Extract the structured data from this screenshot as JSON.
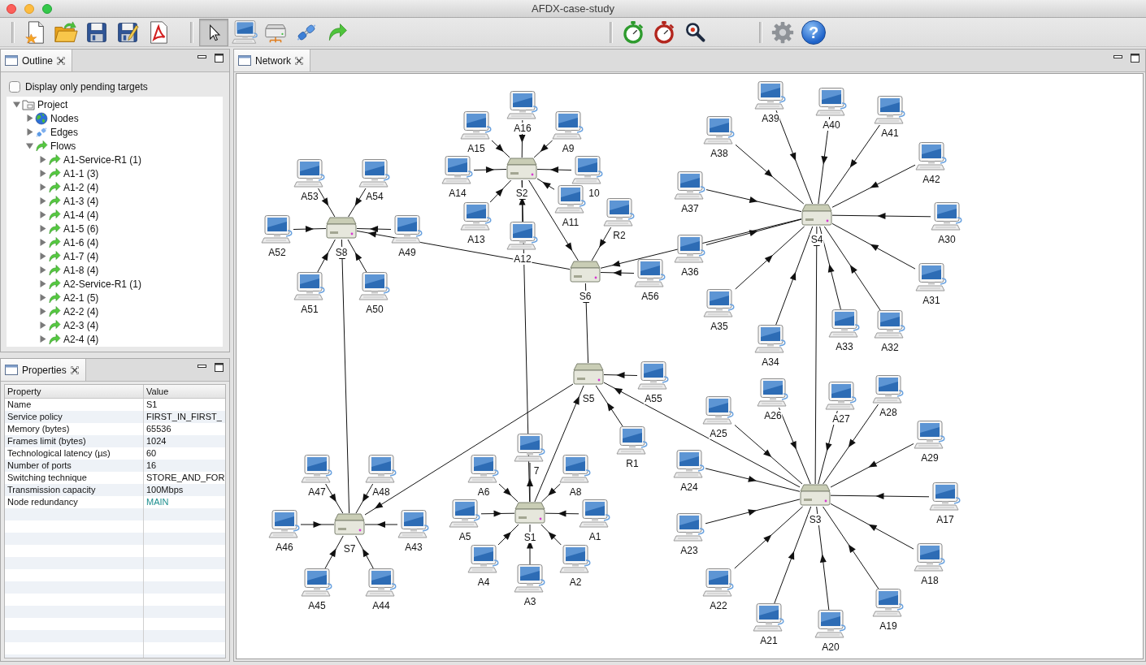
{
  "window": {
    "title": "AFDX-case-study"
  },
  "toolbar": {
    "groups": [
      {
        "items": [
          {
            "kind": "new",
            "selected": false
          },
          {
            "kind": "open",
            "selected": false
          },
          {
            "kind": "save",
            "selected": false
          },
          {
            "kind": "save_as",
            "selected": false
          },
          {
            "kind": "pdf",
            "selected": false
          }
        ]
      },
      {
        "items": [
          {
            "kind": "pointer",
            "selected": true
          },
          {
            "kind": "computer",
            "selected": false
          },
          {
            "kind": "switch",
            "selected": false
          },
          {
            "kind": "link",
            "selected": false
          },
          {
            "kind": "flow",
            "selected": false
          }
        ]
      },
      {
        "items": [
          {
            "kind": "start",
            "selected": false
          },
          {
            "kind": "stop",
            "selected": false
          },
          {
            "kind": "inspect",
            "selected": false
          }
        ]
      },
      {
        "items": [
          {
            "kind": "settings",
            "selected": false
          },
          {
            "kind": "help",
            "label": "?",
            "selected": false
          }
        ]
      }
    ]
  },
  "outline": {
    "tab": "Outline",
    "filter": {
      "label": "Display only pending targets",
      "checked": false
    },
    "tree": [
      {
        "label": "Project",
        "kind": "project",
        "expanded": true,
        "children": [
          {
            "label": "Nodes",
            "kind": "nodes",
            "expanded": false
          },
          {
            "label": "Edges",
            "kind": "edges",
            "expanded": false
          },
          {
            "label": "Flows",
            "kind": "flows",
            "expanded": true,
            "children": [
              {
                "label": "A1-Service-R1 (1)",
                "kind": "flow",
                "expanded": false
              },
              {
                "label": "A1-1 (3)",
                "kind": "flow",
                "expanded": false
              },
              {
                "label": "A1-2 (4)",
                "kind": "flow",
                "expanded": false
              },
              {
                "label": "A1-3 (4)",
                "kind": "flow",
                "expanded": false
              },
              {
                "label": "A1-4 (4)",
                "kind": "flow",
                "expanded": false
              },
              {
                "label": "A1-5 (6)",
                "kind": "flow",
                "expanded": false
              },
              {
                "label": "A1-6 (4)",
                "kind": "flow",
                "expanded": false
              },
              {
                "label": "A1-7 (4)",
                "kind": "flow",
                "expanded": false
              },
              {
                "label": "A1-8 (4)",
                "kind": "flow",
                "expanded": false
              },
              {
                "label": "A2-Service-R1 (1)",
                "kind": "flow",
                "expanded": false
              },
              {
                "label": "A2-1 (5)",
                "kind": "flow",
                "expanded": false
              },
              {
                "label": "A2-2 (4)",
                "kind": "flow",
                "expanded": false
              },
              {
                "label": "A2-3 (4)",
                "kind": "flow",
                "expanded": false
              },
              {
                "label": "A2-4 (4)",
                "kind": "flow",
                "expanded": false
              }
            ]
          }
        ]
      }
    ]
  },
  "properties": {
    "tab": "Properties",
    "columns": [
      "Property",
      "Value"
    ],
    "rows": [
      {
        "property": "Name",
        "value": "S1"
      },
      {
        "property": "Service policy",
        "value": "FIRST_IN_FIRST_"
      },
      {
        "property": "Memory (bytes)",
        "value": "65536"
      },
      {
        "property": "Frames limit (bytes)",
        "value": "1024"
      },
      {
        "property": "Technological latency (µs)",
        "value": "60"
      },
      {
        "property": "Number of ports",
        "value": "16"
      },
      {
        "property": "Switching technique",
        "value": "STORE_AND_FOR"
      },
      {
        "property": "Transmission capacity",
        "value": "100Mbps"
      },
      {
        "property": "Node redundancy",
        "value": "MAIN",
        "color": "#1f9090"
      }
    ]
  },
  "network": {
    "tab": "Network",
    "switches": [
      {
        "label": "S8",
        "hosts": [
          {
            "label": "A53",
            "outgoing": false
          },
          {
            "label": "A54",
            "outgoing": false
          },
          {
            "label": "A52",
            "outgoing": false
          },
          {
            "label": "A49",
            "outgoing": false
          },
          {
            "label": "A51",
            "outgoing": false
          },
          {
            "label": "A50",
            "outgoing": false
          }
        ]
      },
      {
        "label": "S2",
        "hosts": [
          {
            "label": "A16",
            "outgoing": false
          },
          {
            "label": "A15",
            "outgoing": false
          },
          {
            "label": "A9",
            "outgoing": false
          },
          {
            "label": "A14",
            "outgoing": false
          },
          {
            "label": "10",
            "outgoing": false
          },
          {
            "label": "A11",
            "outgoing": false
          },
          {
            "label": "A13",
            "outgoing": false
          },
          {
            "label": "A12",
            "outgoing": false
          }
        ]
      },
      {
        "label": "S6",
        "hosts": [
          {
            "label": "R2",
            "outgoing": false
          },
          {
            "label": "A56",
            "outgoing": false
          }
        ]
      },
      {
        "label": "S4",
        "hosts": [
          {
            "label": "A39",
            "outgoing": false
          },
          {
            "label": "A40",
            "outgoing": false
          },
          {
            "label": "A41",
            "outgoing": false
          },
          {
            "label": "A38",
            "outgoing": false
          },
          {
            "label": "A42",
            "outgoing": false
          },
          {
            "label": "A37",
            "outgoing": false
          },
          {
            "label": "A30",
            "outgoing": false
          },
          {
            "label": "A36",
            "outgoing": false
          },
          {
            "label": "A31",
            "outgoing": false
          },
          {
            "label": "A35",
            "outgoing": false
          },
          {
            "label": "A33",
            "outgoing": false
          },
          {
            "label": "A32",
            "outgoing": false
          },
          {
            "label": "A34",
            "outgoing": false
          }
        ]
      },
      {
        "label": "S7",
        "hosts": [
          {
            "label": "A47",
            "outgoing": false
          },
          {
            "label": "A48",
            "outgoing": false
          },
          {
            "label": "A46",
            "outgoing": false
          },
          {
            "label": "A43",
            "outgoing": false
          },
          {
            "label": "A45",
            "outgoing": false
          },
          {
            "label": "A44",
            "outgoing": false
          }
        ]
      },
      {
        "label": "S1",
        "hosts": [
          {
            "label": "7",
            "outgoing": true
          },
          {
            "label": "A6",
            "outgoing": false
          },
          {
            "label": "A8",
            "outgoing": false
          },
          {
            "label": "A5",
            "outgoing": false
          },
          {
            "label": "A1",
            "outgoing": false
          },
          {
            "label": "A4",
            "outgoing": false
          },
          {
            "label": "A2",
            "outgoing": false
          },
          {
            "label": "A3",
            "outgoing": false
          }
        ]
      },
      {
        "label": "S5",
        "hosts": [
          {
            "label": "A55",
            "outgoing": false
          },
          {
            "label": "R1",
            "outgoing": false
          }
        ]
      },
      {
        "label": "S3",
        "hosts": [
          {
            "label": "A26",
            "outgoing": false
          },
          {
            "label": "A27",
            "outgoing": false
          },
          {
            "label": "A28",
            "outgoing": false
          },
          {
            "label": "A25",
            "outgoing": false
          },
          {
            "label": "A29",
            "outgoing": false
          },
          {
            "label": "A24",
            "outgoing": false
          },
          {
            "label": "A17",
            "outgoing": false
          },
          {
            "label": "A23",
            "outgoing": false
          },
          {
            "label": "A18",
            "outgoing": false
          },
          {
            "label": "A22",
            "outgoing": false
          },
          {
            "label": "A19",
            "outgoing": false
          },
          {
            "label": "A21",
            "outgoing": false
          },
          {
            "label": "A20",
            "outgoing": false
          }
        ]
      }
    ]
  }
}
